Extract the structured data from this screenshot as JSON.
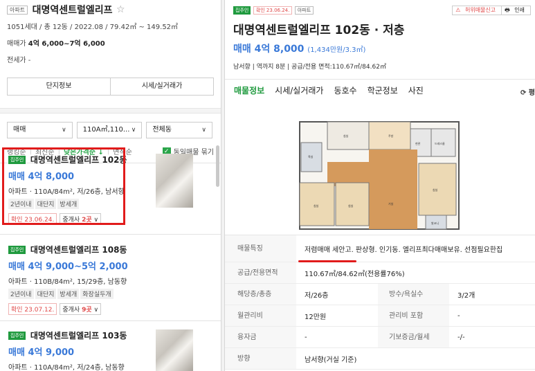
{
  "complex": {
    "type_badge": "아파트",
    "name": "대명역센트럴엘리프",
    "star": "☆",
    "info": "1051세대 / 총 12동 / 2022.08 / 79.42㎡ ~ 149.52㎡",
    "sale_label": "매매가",
    "sale_value": "4억 6,000~7억 6,000",
    "rent_label": "전세가",
    "rent_value": "-",
    "btn_info": "단지정보",
    "btn_price": "시세/실거래가"
  },
  "filters": {
    "trade": "매매",
    "area": "110A㎡,110...",
    "dong": "전체동"
  },
  "sort": {
    "items": [
      "랭킹순",
      "최신순",
      "낮은가격순 ↓",
      "면적순"
    ],
    "same_listing": "동일매물 묶기"
  },
  "listings": [
    {
      "badge": "집주인",
      "title": "대명역센트럴엘리프 102동",
      "price": "매매 4억 8,000",
      "desc": "아파트 · 110A/84m², 저/26층, 남서향",
      "tags": [
        "2년이내",
        "대단지",
        "방세개"
      ],
      "confirm": "확인 23.06.24.",
      "agent": "중개사",
      "agent_count": "2곳"
    },
    {
      "badge": "집주인",
      "title": "대명역센트럴엘리프 108동",
      "price": "매매 4억 9,000~5억 2,000",
      "desc": "아파트 · 110B/84m², 15/29층, 남동향",
      "tags": [
        "2년이내",
        "대단지",
        "방세개",
        "화장실두개"
      ],
      "confirm": "확인 23.07.12.",
      "agent": "중개사",
      "agent_count": "9곳"
    },
    {
      "badge": "집주인",
      "title": "대명역센트럴엘리프 103동",
      "price": "매매 4억 9,000",
      "desc": "아파트 · 110A/84m², 저/24층, 남동향"
    }
  ],
  "detail": {
    "badge_owner": "집주인",
    "badge_confirm": "확인 23.06.24.",
    "badge_type": "아파트",
    "report": "허위매물신고",
    "print": "인쇄",
    "title": "대명역센트럴엘리프 102동 · 저층",
    "price": "매매 4억 8,000",
    "price_per": "(1,434만원/3.3㎡)",
    "sub": "남서향 | 역까지 8분 | 공급/전용 면적:110.67㎡/84.62㎡",
    "tabs": [
      "매물정보",
      "시세/실거래가",
      "동호수",
      "학군정보",
      "사진"
    ],
    "compare": "⟳ 평",
    "rows": [
      {
        "k": "매물특징",
        "v": "저렴매매 세안고. 판상형. 인기동. 엘리프최다매매보유. 선점필요한집"
      },
      {
        "k": "공급/전용면적",
        "v": "110.67㎡/84.62㎡(전용률76%)"
      },
      {
        "k": "해당층/총층",
        "v": "저/26층",
        "k2": "방수/욕실수",
        "v2": "3/2개"
      },
      {
        "k": "월관리비",
        "v": "12만원",
        "k2": "관리비 포함",
        "v2": "-"
      },
      {
        "k": "융자금",
        "v": "-",
        "k2": "기보증금/월세",
        "v2": "-/-"
      },
      {
        "k": "방향",
        "v": "남서향(거실 기준)"
      }
    ]
  },
  "floorplan_labels": [
    "침실",
    "침실",
    "침실",
    "거실",
    "주방",
    "욕실",
    "드레스룸",
    "현관",
    "발코니",
    "침실"
  ],
  "colors": {
    "accent": "#1f9a3e",
    "price": "#3a79d8",
    "alert": "#e11b1b"
  }
}
